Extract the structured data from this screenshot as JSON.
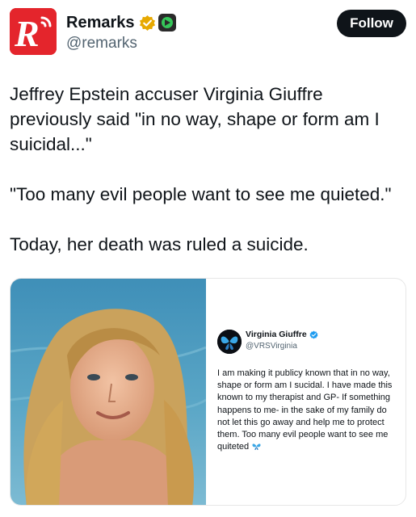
{
  "post": {
    "author": {
      "display_name": "Remarks",
      "handle": "@remarks",
      "avatar_icon": "remarks-logo-icon",
      "avatar_color": "#e4252c",
      "verified_color": "#e7a900"
    },
    "follow_label": "Follow",
    "text_paragraphs": [
      "Jeffrey Epstein accuser Virginia Giuffre previously said \"in no way, shape or form am I suicidal...\"",
      "\"Too many evil people want to see me quieted.\"",
      "Today, her death was ruled a suicide."
    ]
  },
  "embedded": {
    "display_name": "Virginia Giuffre",
    "handle": "@VRSVirginia",
    "verified_color": "#1d9bf0",
    "avatar_icon": "butterfly-icon",
    "text": "I am making it publicy known that in no way, shape or form am I sucidal. I have made this known to my therapist and GP- If something happens to me- in the sake of my family do not let this go away and help me to protect them. Too many evil people want to see me quiteted",
    "trailing_emoji_icon": "butterfly-icon"
  },
  "photo": {
    "subject": "portrait-photo"
  }
}
